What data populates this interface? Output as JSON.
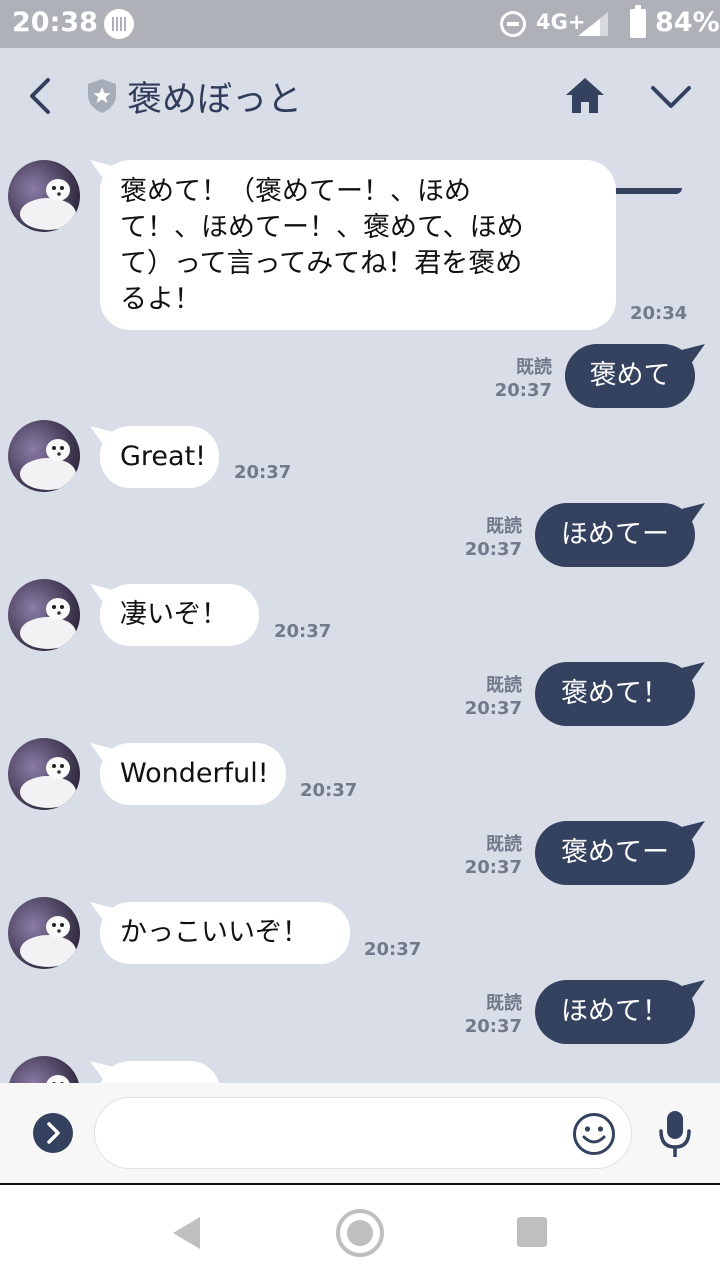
{
  "status_bar": {
    "time": "20:38",
    "network": "4G+",
    "battery": "84%"
  },
  "header": {
    "title": "褒めぼっと"
  },
  "messages": [
    {
      "from": "bot",
      "lines": [
        "褒めて！（褒めてー！、ほめ",
        "て！、ほめてー！、褒めて、ほめ",
        "て）って言ってみてね！君を褒め",
        "るよ！"
      ],
      "time": "20:34"
    },
    {
      "from": "me",
      "text": "褒めて",
      "read": "既読",
      "time": "20:37"
    },
    {
      "from": "bot",
      "text": "Great!",
      "time": "20:37"
    },
    {
      "from": "me",
      "text": "ほめてー",
      "read": "既読",
      "time": "20:37"
    },
    {
      "from": "bot",
      "text": "凄いぞ！",
      "time": "20:37"
    },
    {
      "from": "me",
      "text": "褒めて！",
      "read": "既読",
      "time": "20:37"
    },
    {
      "from": "bot",
      "text": "Wonderful!",
      "time": "20:37"
    },
    {
      "from": "me",
      "text": "褒めてー",
      "read": "既読",
      "time": "20:37"
    },
    {
      "from": "bot",
      "text": "かっこいいぞ！",
      "time": "20:37"
    },
    {
      "from": "me",
      "text": "ほめて！",
      "read": "既読",
      "time": "20:37"
    }
  ],
  "input": {
    "placeholder": "",
    "value": ""
  },
  "icons": {
    "back": "chevron-left-icon",
    "official": "shield-star-icon",
    "home": "home-icon",
    "menu": "chevron-down-icon",
    "expand": "chevron-right-icon",
    "emoji": "smiley-icon",
    "mic": "microphone-icon"
  },
  "colors": {
    "accent": "#34425f",
    "background": "#d9dde8",
    "incoming": "#ffffff",
    "status_bar": "#aeb1b8"
  }
}
